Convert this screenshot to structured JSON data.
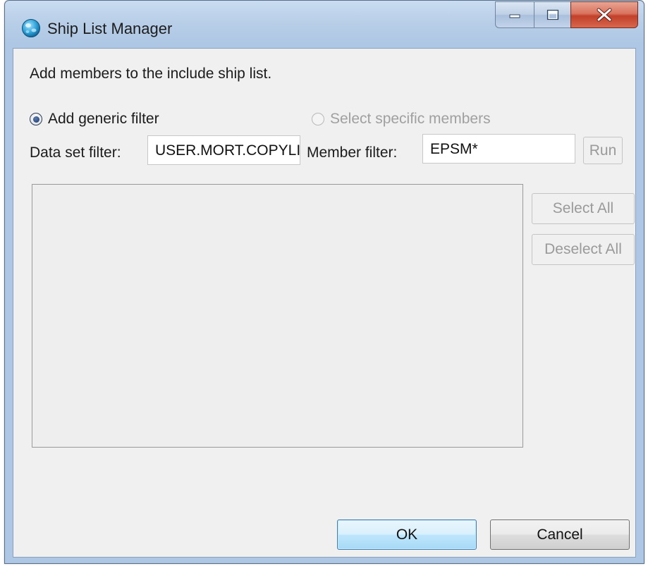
{
  "window": {
    "title": "Ship List Manager",
    "app_icon": "globe-icon",
    "caption_icons": [
      "minimize-icon",
      "maximize-icon",
      "close-icon"
    ]
  },
  "dialog": {
    "instruction": "Add members to the include ship list.",
    "radio_generic": {
      "label": "Add generic filter",
      "selected": true
    },
    "radio_specific": {
      "label": "Select specific members",
      "selected": false,
      "enabled": false
    },
    "dataset_filter": {
      "label": "Data set filter:",
      "value": "USER.MORT.COPYLIB"
    },
    "member_filter": {
      "label": "Member filter:",
      "value": "EPSM*"
    },
    "run_label": "Run",
    "select_all_label": "Select All",
    "deselect_all_label": "Deselect All",
    "members": []
  },
  "footer": {
    "ok_label": "OK",
    "cancel_label": "Cancel"
  },
  "colors": {
    "accent_ok": "#a7d9f5",
    "close_button": "#c2402a",
    "disabled_text": "#a0a0a0",
    "client_bg": "#f0f0f0"
  }
}
